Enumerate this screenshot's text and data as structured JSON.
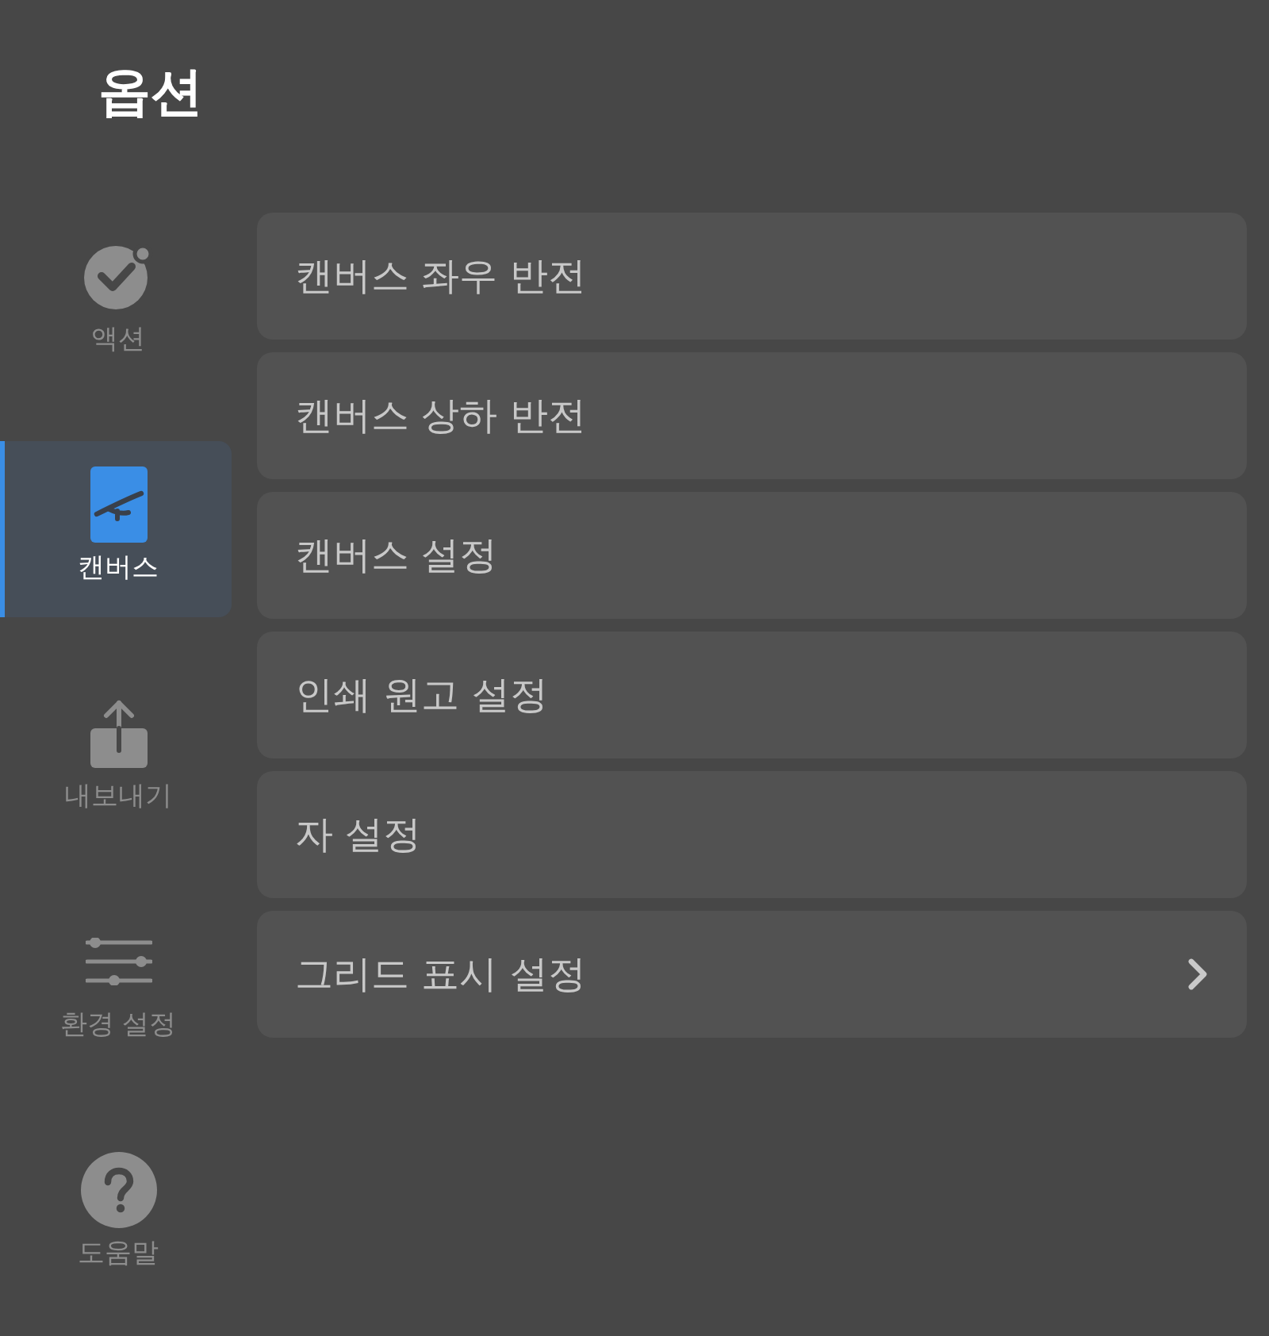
{
  "title": "옵션",
  "sidebar": {
    "items": [
      {
        "label": "액션",
        "selected": false
      },
      {
        "label": "캔버스",
        "selected": true
      },
      {
        "label": "내보내기",
        "selected": false
      },
      {
        "label": "환경 설정",
        "selected": false
      },
      {
        "label": "도움말",
        "selected": false
      }
    ]
  },
  "menu": {
    "items": [
      {
        "label": "캔버스 좌우 반전",
        "kind": "action"
      },
      {
        "label": "캔버스 상하 반전",
        "kind": "action"
      },
      {
        "label": "캔버스 설정",
        "kind": "action"
      },
      {
        "label": "인쇄 원고 설정",
        "kind": "action"
      },
      {
        "label": "자 설정",
        "kind": "action"
      },
      {
        "label": "그리드 표시 설정",
        "kind": "submenu"
      }
    ]
  }
}
